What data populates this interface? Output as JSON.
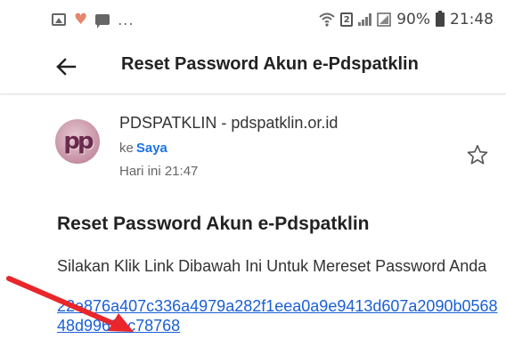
{
  "status_bar": {
    "notification_icons": [
      "image-icon",
      "heart-icon",
      "chat-icon"
    ],
    "more_indicator": "...",
    "sim_label": "2",
    "battery": "90%",
    "time": "21:48"
  },
  "app_bar": {
    "title": "Reset Password Akun e-Pdspatklin",
    "back_icon": "arrow-left-icon"
  },
  "email": {
    "avatar_text": "pp",
    "sender": "PDSPATKLIN - pdspatklin.or.id",
    "to_prefix": "ke",
    "to_name": "Saya",
    "date": "Hari ini 21:47",
    "star_icon": "star-outline-icon",
    "heading": "Reset Password Akun e-Pdspatklin",
    "message": "Silakan Klik Link Dibawah Ini Untuk Mereset Password Anda",
    "link": "22e876a407c336a4979a282f1eea0a9e9413d607a2090b056848d9968cc78768"
  },
  "colors": {
    "link": "#1a5fd6",
    "recipient": "#1a73e8",
    "annotation_arrow": "#e8262b"
  }
}
